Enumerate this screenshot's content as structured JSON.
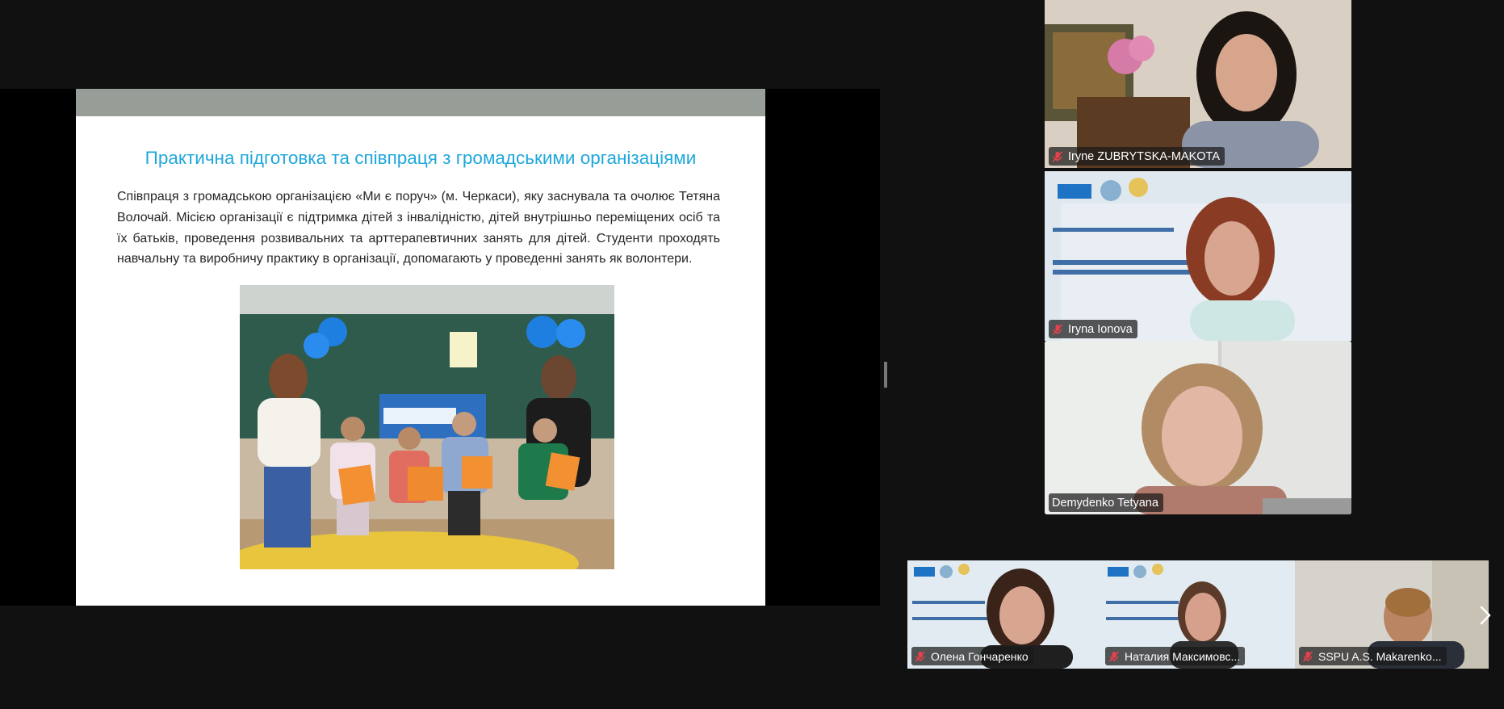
{
  "slide": {
    "title": "Практична підготовка та співпраця з громадськими організаціями",
    "body": "Співпраця з громадською організацією «Ми є поруч» (м. Черкаси), яку заснувала та очолює Тетяна Волочай. Місією організації є підтримка дітей з інвалідністю, дітей внутрішньо переміщених осіб та їх батьків, проведення розвивальних та арттерапевтичних занять для дітей. Студенти проходять навчальну та виробничу практику в організації, допомагають у проведенні занять як волонтери."
  },
  "participants": {
    "gallery": [
      {
        "name": "Iryne ZUBRYTSKA-MAKOTA",
        "muted": true,
        "active": false
      },
      {
        "name": "Iryna Ionova",
        "muted": true,
        "active": false
      },
      {
        "name": "Demydenko Tetyana",
        "muted": false,
        "active": true
      }
    ],
    "filmstrip": [
      {
        "name": "Олена Гончаренко",
        "muted": true
      },
      {
        "name": "Наталия Максимовс...",
        "muted": true
      },
      {
        "name": "SSPU A.S. Makarenko...",
        "muted": true
      }
    ]
  },
  "icons": {
    "muted_mic": "mic-off-icon",
    "next": "chevron-right-icon"
  },
  "colors": {
    "background": "#111111",
    "slide_title": "#1fa7dc",
    "active_speaker_border": "#2ed87a",
    "muted_icon": "#e8414d"
  }
}
